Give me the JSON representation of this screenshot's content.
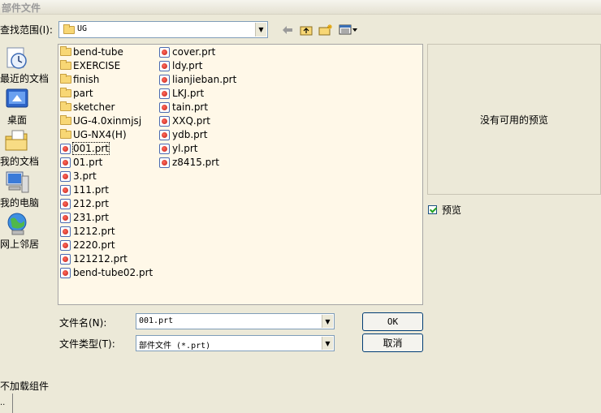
{
  "window": {
    "title": "部件文件"
  },
  "lookin": {
    "label": "查找范围(I):",
    "value": "UG"
  },
  "places": [
    {
      "label": "最近的文档",
      "icon": "recent-documents-icon"
    },
    {
      "label": "桌面",
      "icon": "desktop-icon"
    },
    {
      "label": "我的文档",
      "icon": "my-documents-icon"
    },
    {
      "label": "我的电脑",
      "icon": "my-computer-icon"
    },
    {
      "label": "网上邻居",
      "icon": "network-icon"
    }
  ],
  "files": {
    "column1": [
      {
        "name": "bend-tube",
        "type": "folder"
      },
      {
        "name": "EXERCISE",
        "type": "folder"
      },
      {
        "name": "finish",
        "type": "folder"
      },
      {
        "name": "part",
        "type": "folder"
      },
      {
        "name": "sketcher",
        "type": "folder"
      },
      {
        "name": "UG-4.0xinmjsj",
        "type": "folder"
      },
      {
        "name": "UG-NX4(H)",
        "type": "folder"
      },
      {
        "name": "001.prt",
        "type": "prt",
        "selected": true
      },
      {
        "name": "01.prt",
        "type": "prt"
      },
      {
        "name": "3.prt",
        "type": "prt"
      },
      {
        "name": "111.prt",
        "type": "prt"
      },
      {
        "name": "212.prt",
        "type": "prt"
      },
      {
        "name": "231.prt",
        "type": "prt"
      },
      {
        "name": "1212.prt",
        "type": "prt"
      },
      {
        "name": "2220.prt",
        "type": "prt"
      },
      {
        "name": "121212.prt",
        "type": "prt"
      },
      {
        "name": "bend-tube02.prt",
        "type": "prt"
      }
    ],
    "column2": [
      {
        "name": "cover.prt",
        "type": "prt"
      },
      {
        "name": "ldy.prt",
        "type": "prt"
      },
      {
        "name": "lianjieban.prt",
        "type": "prt"
      },
      {
        "name": "LKJ.prt",
        "type": "prt"
      },
      {
        "name": "tain.prt",
        "type": "prt"
      },
      {
        "name": "XXQ.prt",
        "type": "prt"
      },
      {
        "name": "ydb.prt",
        "type": "prt"
      },
      {
        "name": "yl.prt",
        "type": "prt"
      },
      {
        "name": "z8415.prt",
        "type": "prt"
      }
    ]
  },
  "preview": {
    "empty_text": "没有可用的预览",
    "checkbox_label": "预览",
    "checked": true
  },
  "filename": {
    "label": "文件名(N):",
    "value": "001.prt"
  },
  "filetype": {
    "label": "文件类型(T):",
    "value": "部件文件 (*.prt)"
  },
  "buttons": {
    "ok": "OK",
    "cancel": "取消"
  },
  "bottom": {
    "label": "不加载组件",
    "box_text": ".."
  }
}
